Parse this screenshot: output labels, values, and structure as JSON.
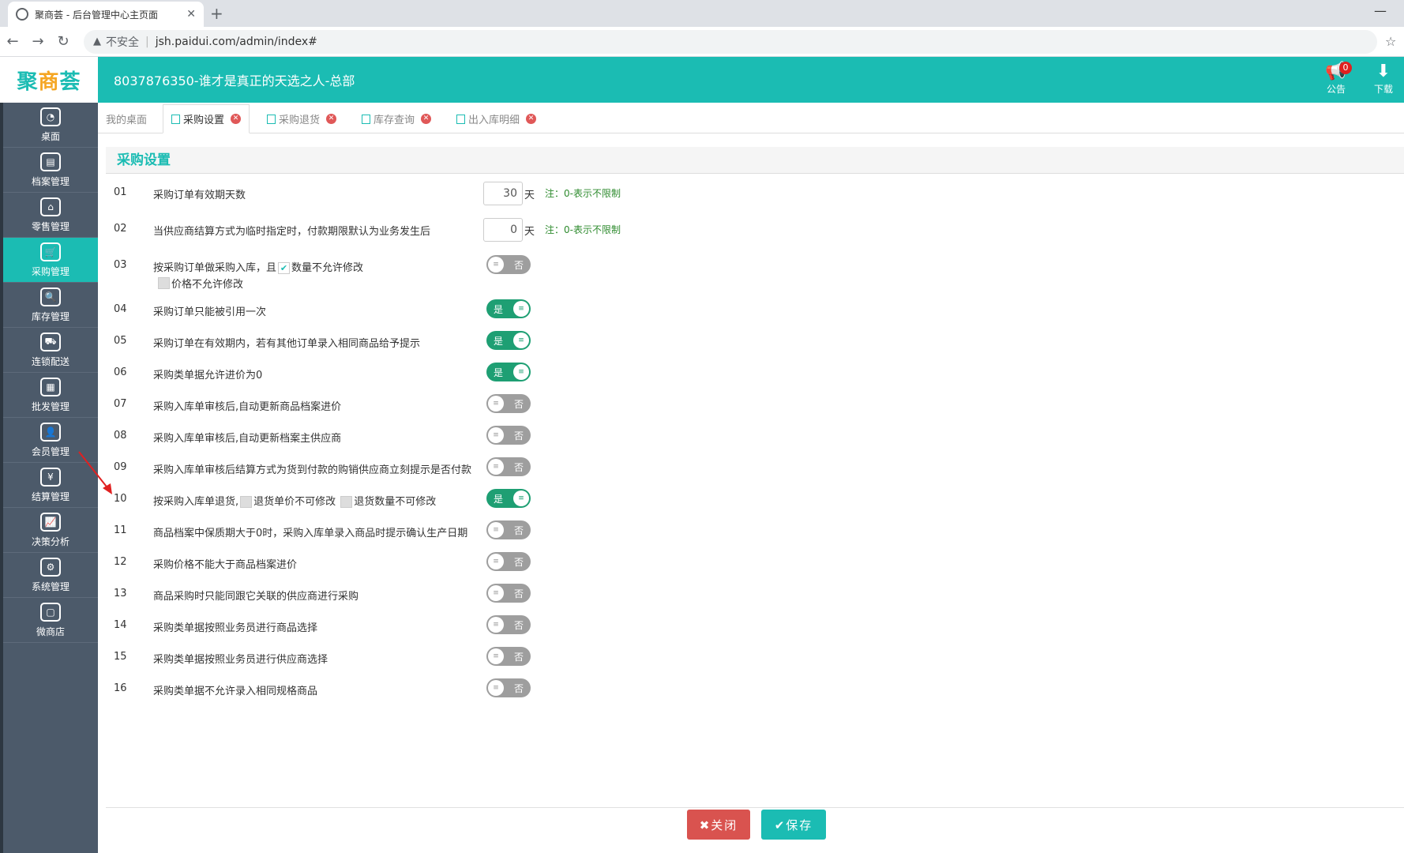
{
  "browser": {
    "tab_title": "聚商荟 - 后台管理中心主页面",
    "close_tab": "✕",
    "new_tab": "+",
    "minimize": "—",
    "insecure_label": "不安全",
    "url": "jsh.paidui.com/admin/index#"
  },
  "header": {
    "logo_left": "聚",
    "logo_mid": "商",
    "logo_right": "荟",
    "company": "8037876350-谁才是真正的天选之人-总部",
    "notice_label": "公告",
    "notice_count": "0",
    "download_label": "下载"
  },
  "sidebar": {
    "items": [
      {
        "label": "桌面",
        "icon": "dashboard-icon",
        "active": false
      },
      {
        "label": "档案管理",
        "icon": "archive-icon",
        "active": false
      },
      {
        "label": "零售管理",
        "icon": "store-icon",
        "active": false
      },
      {
        "label": "采购管理",
        "icon": "cart-icon",
        "active": true
      },
      {
        "label": "库存管理",
        "icon": "stock-icon",
        "active": false
      },
      {
        "label": "连锁配送",
        "icon": "truck-icon",
        "active": false
      },
      {
        "label": "批发管理",
        "icon": "wholesale-icon",
        "active": false
      },
      {
        "label": "会员管理",
        "icon": "member-icon",
        "active": false
      },
      {
        "label": "结算管理",
        "icon": "settle-icon",
        "active": false
      },
      {
        "label": "决策分析",
        "icon": "chart-icon",
        "active": false
      },
      {
        "label": "系统管理",
        "icon": "gear-icon",
        "active": false
      },
      {
        "label": "微商店",
        "icon": "shop-bag-icon",
        "active": false
      }
    ]
  },
  "tabs": [
    {
      "label": "我的桌面"
    },
    {
      "label": "采购设置"
    },
    {
      "label": "采购退货"
    },
    {
      "label": "库存查询"
    },
    {
      "label": "出入库明细"
    }
  ],
  "page": {
    "title": "采购设置",
    "rows": [
      {
        "num": "01",
        "label": "采购订单有效期天数",
        "value": "30",
        "unit": "天",
        "note": "注：0-表示不限制"
      },
      {
        "num": "02",
        "label": "当供应商结算方式为临时指定时，付款期限默认为业务发生后",
        "value": "0",
        "unit": "天",
        "note": "注：0-表示不限制"
      },
      {
        "num": "03",
        "label": "按采购订单做采购入库，且",
        "check1": "数量不允许修改",
        "check2": "价格不允许修改",
        "toggle": "否"
      },
      {
        "num": "04",
        "label": "采购订单只能被引用一次",
        "toggle": "是"
      },
      {
        "num": "05",
        "label": "采购订单在有效期内，若有其他订单录入相同商品给予提示",
        "toggle": "是"
      },
      {
        "num": "06",
        "label": "采购类单据允许进价为0",
        "toggle": "是"
      },
      {
        "num": "07",
        "label": "采购入库单审核后,自动更新商品档案进价",
        "toggle": "否"
      },
      {
        "num": "08",
        "label": "采购入库单审核后,自动更新档案主供应商",
        "toggle": "否"
      },
      {
        "num": "09",
        "label": "采购入库单审核后结算方式为货到付款的购销供应商立刻提示是否付款",
        "toggle": "否"
      },
      {
        "num": "10",
        "label": "按采购入库单退货,",
        "check1": "退货单价不可修改",
        "check2": "退货数量不可修改",
        "toggle": "是"
      },
      {
        "num": "11",
        "label": "商品档案中保质期大于0时，采购入库单录入商品时提示确认生产日期",
        "toggle": "否"
      },
      {
        "num": "12",
        "label": "采购价格不能大于商品档案进价",
        "toggle": "否"
      },
      {
        "num": "13",
        "label": "商品采购时只能同跟它关联的供应商进行采购",
        "toggle": "否"
      },
      {
        "num": "14",
        "label": "采购类单据按照业务员进行商品选择",
        "toggle": "否"
      },
      {
        "num": "15",
        "label": "采购类单据按照业务员进行供应商选择",
        "toggle": "否"
      },
      {
        "num": "16",
        "label": "采购类单据不允许录入相同规格商品",
        "toggle": "否"
      }
    ]
  },
  "footer": {
    "close_label": "✖关闭",
    "save_label": "✔保存"
  },
  "colors": {
    "accent": "#1bbcb3",
    "toggle_on": "#1e9f73",
    "toggle_off": "#9e9e9e",
    "danger": "#d9534f",
    "sidebar": "#4c5a6a"
  }
}
